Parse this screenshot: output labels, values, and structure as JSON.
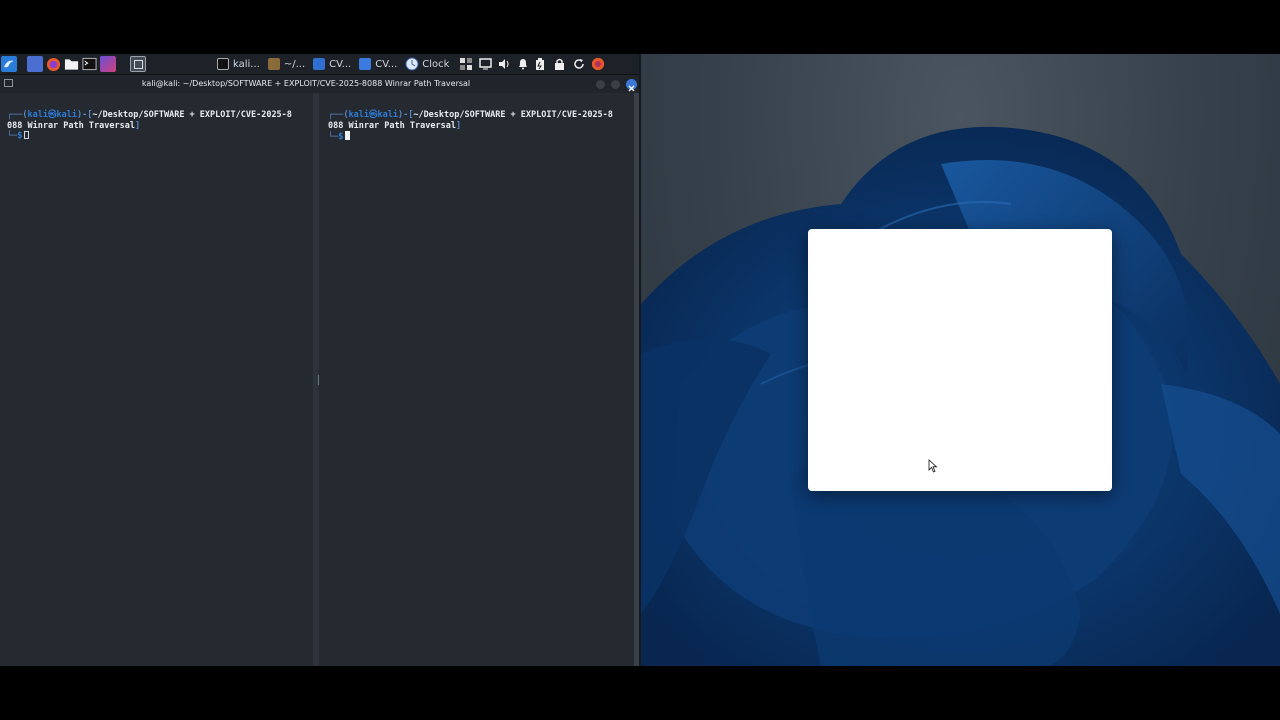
{
  "kali": {
    "panel": {
      "tasks": [
        {
          "label": "kali...",
          "icon": "terminal-icon"
        },
        {
          "label": "~/...",
          "icon": "terminal-icon"
        },
        {
          "label": "CV...",
          "icon": "folder-icon"
        },
        {
          "label": "CV...",
          "icon": "folder-icon"
        }
      ],
      "clock_label": "Clock"
    },
    "window_title": "kali@kali: ~/Desktop/SOFTWARE + EXPLOIT/CVE-2025-8088 Winrar Path Traversal",
    "left_terminal": {
      "user": "kali",
      "host": "kali",
      "path_line1": "~/Desktop/SOFTWARE + EXPLOIT/CVE-2025-8",
      "path_line2": "088 Winrar Path Traversal",
      "prompt_symbol": "$"
    },
    "right_terminal": {
      "user": "kali",
      "host": "kali",
      "path_line1": "~/Desktop/SOFTWARE + EXPLOIT/CVE-2025-8",
      "path_line2": "088 Winrar Path Traversal",
      "prompt_symbol": "$"
    }
  },
  "colors": {
    "kali_bg": "#232830",
    "prompt_blue": "#2d7bd6",
    "windows_blue": "#0f3e7a",
    "close_button": "#3b78d8"
  }
}
